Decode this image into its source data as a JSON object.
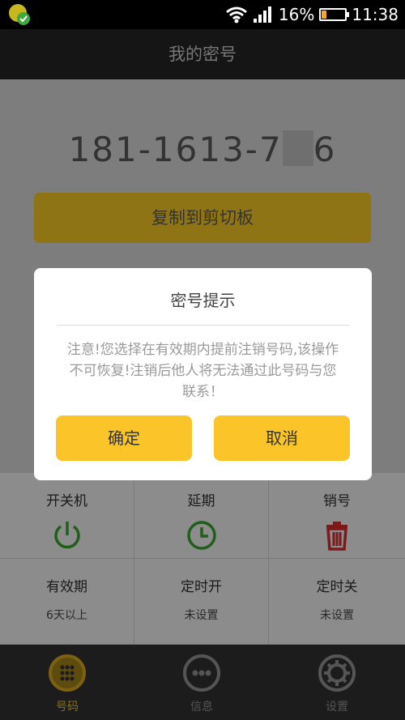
{
  "status_bar": {
    "battery": "16%",
    "time": "11:38"
  },
  "title": "我的密号",
  "number": {
    "prefix": "181-1613-7",
    "suffix": "6"
  },
  "copy_button": "复制到剪切板",
  "grid": [
    {
      "label": "开关机",
      "icon": "power-icon",
      "color": "#1f5f1a"
    },
    {
      "label": "延期",
      "icon": "clock-icon",
      "color": "#1f5f1a"
    },
    {
      "label": "销号",
      "icon": "trash-icon",
      "color": "#7a1a1a"
    },
    {
      "label": "有效期",
      "sub": "6天以上"
    },
    {
      "label": "定时开",
      "sub": "未设置"
    },
    {
      "label": "定时关",
      "sub": "未设置"
    }
  ],
  "bottom_nav": [
    {
      "label": "号码",
      "icon": "dialpad-icon",
      "active": true
    },
    {
      "label": "信息",
      "icon": "message-icon"
    },
    {
      "label": "设置",
      "icon": "gear-icon"
    }
  ],
  "dialog": {
    "title": "密号提示",
    "message": "注意!您选择在有效期内提前注销号码,该操作不可恢复!注销后他人将无法通过此号码与您联系！",
    "confirm": "确定",
    "cancel": "取消"
  },
  "colors": {
    "accent": "#fbc52a",
    "dim_accent": "#8f7416"
  }
}
